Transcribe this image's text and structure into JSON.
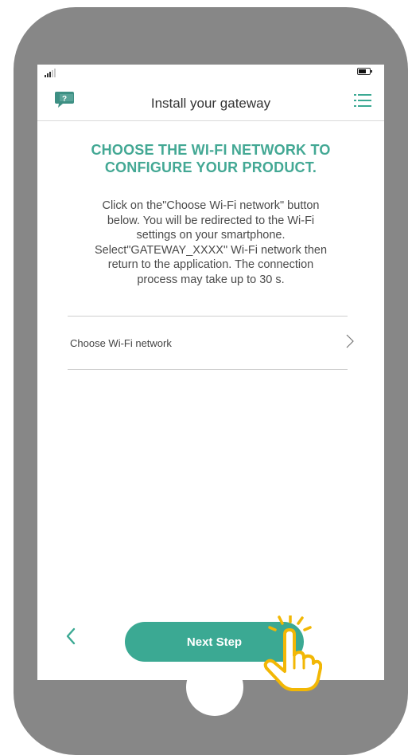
{
  "colors": {
    "accent": "#3ba993",
    "heading": "#43a894",
    "phone_frame": "#878787",
    "hand_highlight": "#f2b705"
  },
  "status_bar": {
    "signal_icon": "signal-bars-icon",
    "battery_icon": "battery-icon"
  },
  "nav": {
    "title": "Install your gateway",
    "help_icon": "help-chat-bubble-icon",
    "menu_icon": "list-menu-icon"
  },
  "main": {
    "heading_line1": "CHOOSE THE WI-FI NETWORK TO",
    "heading_line2": "CONFIGURE YOUR PRODUCT.",
    "instructions": [
      "Click on the\"Choose Wi-Fi network\" button",
      "below. You will be redirected to the Wi-Fi",
      "settings on your smartphone.",
      "Select\"GATEWAY_XXXX\" Wi-Fi network then",
      "return to the application. The connection",
      "process may take up to 30 s."
    ],
    "wifi_row_label": "Choose Wi-Fi network",
    "wifi_row_icon": "chevron-right-icon"
  },
  "footer": {
    "back_icon": "chevron-left-icon",
    "next_label": "Next Step"
  },
  "overlay": {
    "hand_icon": "tap-hand-icon"
  }
}
